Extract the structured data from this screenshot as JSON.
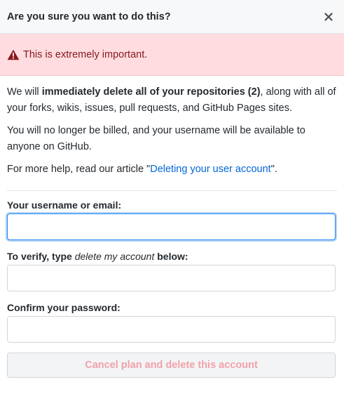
{
  "dialog": {
    "title": "Are you sure you want to do this?",
    "close_icon": "close-icon"
  },
  "flash": {
    "icon": "warning-icon",
    "text": "This is extremely important."
  },
  "body": {
    "p1_pre": "We will ",
    "p1_bold": "immediately delete all of your repositories (2)",
    "p1_post": ", along with all of your forks, wikis, issues, pull requests, and GitHub Pages sites.",
    "p2": "You will no longer be billed, and your username will be available to anyone on GitHub.",
    "p3_pre": "For more help, read our article \"",
    "p3_link": "Deleting your user account",
    "p3_post": "\"."
  },
  "form": {
    "username_label": "Your username or email:",
    "username_value": "",
    "verify_label_pre": "To verify, type ",
    "verify_label_phrase": "delete my account",
    "verify_label_post": " below:",
    "verify_value": "",
    "password_label": "Confirm your password:",
    "password_value": "",
    "submit_label": "Cancel plan and delete this account"
  },
  "colors": {
    "flash_bg": "#ffdce0",
    "flash_text": "#86181d",
    "link": "#0366d6",
    "danger_disabled_text": "#f1a2a8",
    "focus_border": "#2188ff"
  }
}
